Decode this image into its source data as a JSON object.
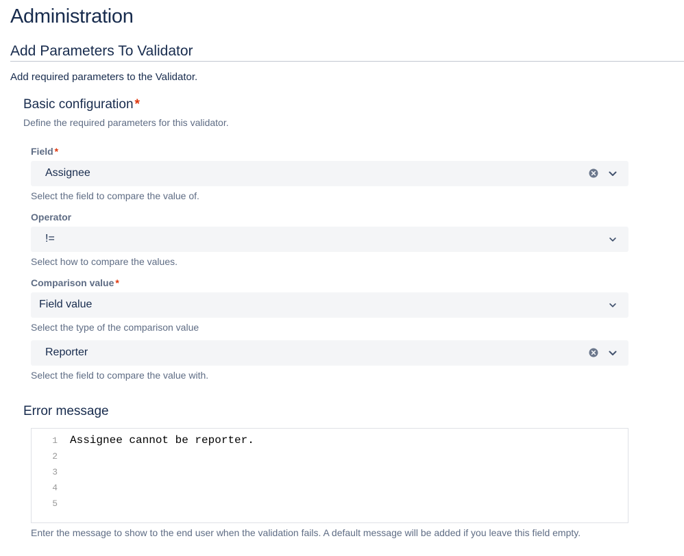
{
  "page": {
    "title": "Administration"
  },
  "section": {
    "title": "Add Parameters To Validator",
    "description": "Add required parameters to the Validator."
  },
  "basic_config": {
    "title": "Basic configuration",
    "required_mark": "*",
    "description": "Define the required parameters for this validator."
  },
  "field": {
    "label": "Field",
    "required_mark": "*",
    "value": "Assignee",
    "helper": "Select the field to compare the value of."
  },
  "operator": {
    "label": "Operator",
    "value": "!=",
    "helper": "Select how to compare the values."
  },
  "comparison": {
    "label": "Comparison value",
    "required_mark": "*",
    "type_value": "Field value",
    "type_helper": "Select the type of the comparison value",
    "field_value": "Reporter",
    "field_helper": "Select the field to compare the value with."
  },
  "error_message": {
    "title": "Error message",
    "line_numbers": [
      "1",
      "2",
      "3",
      "4",
      "5"
    ],
    "lines": [
      "Assignee cannot be reporter.",
      "",
      "",
      "",
      ""
    ],
    "helper": "Enter the message to show to the end user when the validation fails. A default message will be added if you leave this field empty."
  },
  "icons": {
    "clear": "clear-icon",
    "chevron": "chevron-down-icon"
  },
  "colors": {
    "text": "#172b4d",
    "subtle_text": "#5e6c84",
    "required": "#de350b",
    "field_bg": "#f4f5f7",
    "icon": "#6b778c"
  }
}
